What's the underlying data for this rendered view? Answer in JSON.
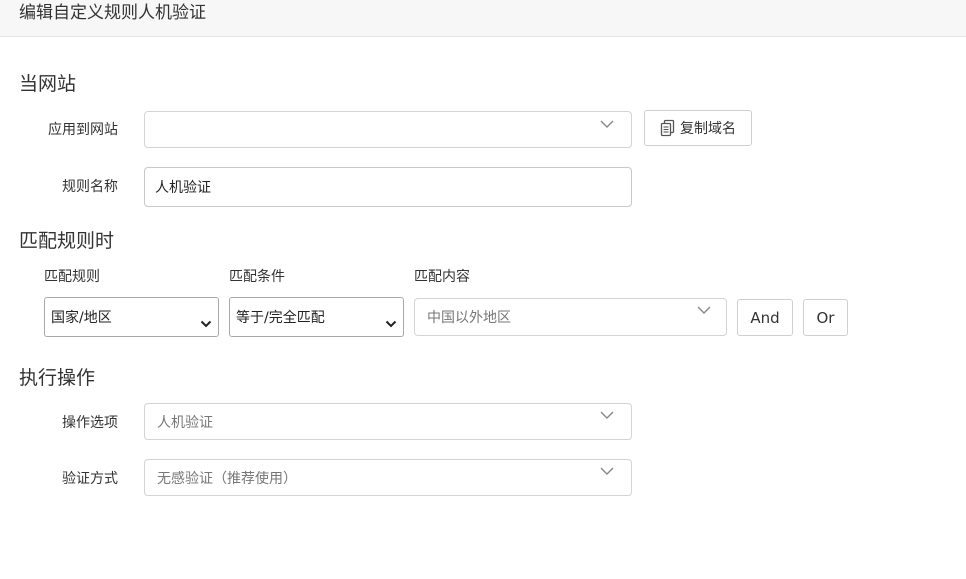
{
  "header": {
    "title": "编辑自定义规则人机验证"
  },
  "section_site": {
    "title": "当网站",
    "apply_label": "应用到网站",
    "apply_value": "",
    "copy_button": "复制域名",
    "name_label": "规则名称",
    "name_value": "人机验证"
  },
  "section_match": {
    "title": "匹配规则时",
    "col_rule": "匹配规则",
    "col_condition": "匹配条件",
    "col_content": "匹配内容",
    "rule_value": "国家/地区",
    "condition_value": "等于/完全匹配",
    "content_value": "中国以外地区",
    "and_button": "And",
    "or_button": "Or"
  },
  "section_action": {
    "title": "执行操作",
    "option_label": "操作选项",
    "option_value": "人机验证",
    "verify_label": "验证方式",
    "verify_value": "无感验证（推荐使用）"
  },
  "icons": {
    "copy": "copy-icon",
    "dropdown": "chevron-down-icon"
  }
}
